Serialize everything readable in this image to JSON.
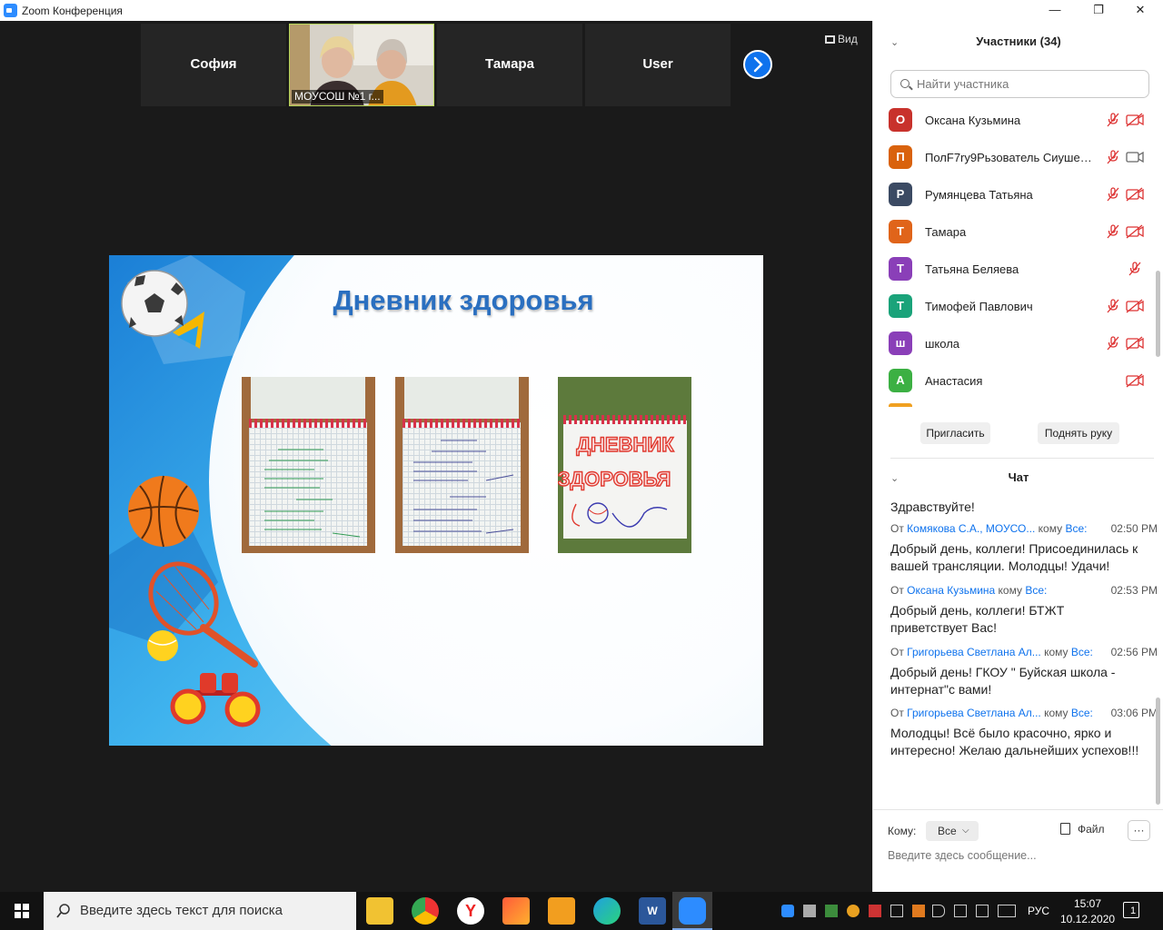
{
  "window": {
    "title": "Zoom Конференция"
  },
  "video_strip": {
    "tiles": [
      {
        "name": "София"
      },
      {
        "name": "МОУСОШ №1 г..."
      },
      {
        "name": "Тамара"
      },
      {
        "name": "User"
      }
    ],
    "view_label": "Вид"
  },
  "slide": {
    "title": "Дневник здоровья"
  },
  "participants": {
    "header": "Участники (34)",
    "search_placeholder": "Найти участника",
    "list": [
      {
        "initial": "О",
        "name": "Оксана Кузьмина",
        "color": "#c8322c"
      },
      {
        "initial": "П",
        "name": "ПолF7ry9Pьзователь Сиушева ...",
        "color": "#d9620c"
      },
      {
        "initial": "Р",
        "name": "Румянцева Татьяна",
        "color": "#3b4a63"
      },
      {
        "initial": "Т",
        "name": "Тамара",
        "color": "#e0641a"
      },
      {
        "initial": "Т",
        "name": "Татьяна Беляева",
        "color": "#8a3fb8"
      },
      {
        "initial": "Т",
        "name": "Тимофей Павлович",
        "color": "#1aa37a"
      },
      {
        "initial": "ш",
        "name": "школа",
        "color": "#8a3fb8"
      },
      {
        "initial": "А",
        "name": "Анастасия",
        "color": "#3cb043"
      }
    ],
    "invite_label": "Пригласить",
    "raise_hand_label": "Поднять руку"
  },
  "chat": {
    "header": "Чат",
    "first_text": "Здравствуйте!",
    "from_prefix": "От",
    "to_word": "кому",
    "messages": [
      {
        "from": "Комякова С.А., МОУСО...",
        "to": "Все:",
        "time": "02:50 PM",
        "text": "Добрый день, коллеги! Присоединилась к вашей трансляции. Молодцы! Удачи!"
      },
      {
        "from": "Оксана Кузьмина",
        "to": "Все:",
        "time": "02:53 PM",
        "text": "Добрый день, коллеги! БТЖТ приветствует Вас!"
      },
      {
        "from": "Григорьева Светлана Ал...",
        "to": "Все:",
        "time": "02:56 PM",
        "text": "Добрый день! ГКОУ \" Буйская школа - интернат\"с вами!"
      },
      {
        "from": "Григорьева Светлана Ал...",
        "to": "Все:",
        "time": "03:06 PM",
        "text": "Молодцы! Всё было красочно, ярко и интересно! Желаю дальнейших успехов!!!"
      }
    ],
    "to_label": "Кому:",
    "to_value": "Все",
    "file_label": "Файл",
    "more_label": "···",
    "input_placeholder": "Введите здесь сообщение..."
  },
  "taskbar": {
    "search_placeholder": "Введите здесь текст для поиска",
    "language": "РУС",
    "time": "15:07",
    "date": "10.12.2020",
    "notification_count": "1"
  }
}
